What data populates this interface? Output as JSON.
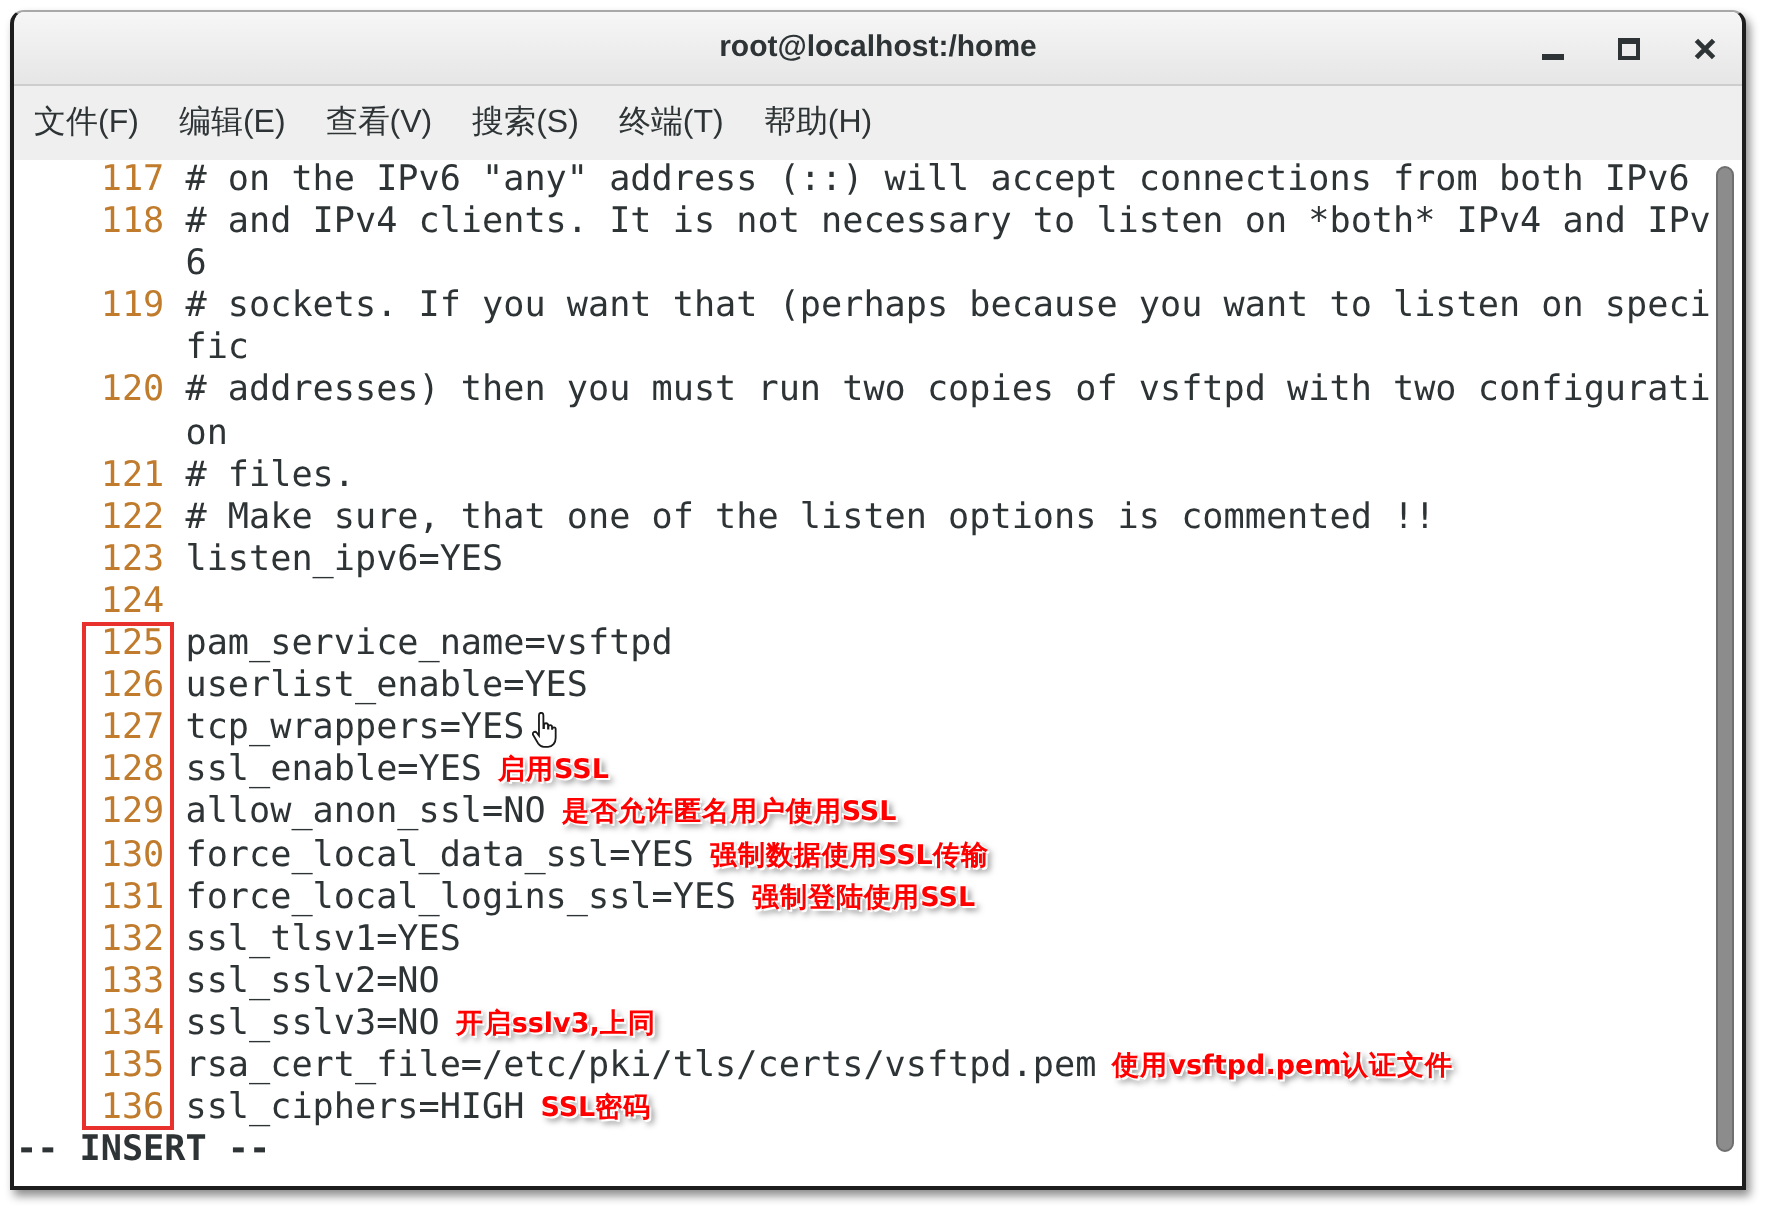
{
  "window": {
    "title": "root@localhost:/home"
  },
  "menu": [
    "文件(F)",
    "编辑(E)",
    "查看(V)",
    "搜索(S)",
    "终端(T)",
    "帮助(H)"
  ],
  "sections": [
    {
      "framed": false,
      "lines": [
        {
          "number": "117",
          "text": "# on the IPv6 \"any\" address (::) will accept connections from both IPv6",
          "mouse_pointer": false
        },
        {
          "number": "118",
          "text": "# and IPv4 clients. It is not necessary to listen on *both* IPv4 and IPv6",
          "mouse_pointer": false
        },
        {
          "number": "119",
          "text": "# sockets. If you want that (perhaps because you want to listen on specific",
          "mouse_pointer": false
        },
        {
          "number": "120",
          "text": "# addresses) then you must run two copies of vsftpd with two configuration",
          "mouse_pointer": false
        },
        {
          "number": "121",
          "text": "# files.",
          "mouse_pointer": false
        },
        {
          "number": "122",
          "text": "# Make sure, that one of the listen options is commented !!",
          "mouse_pointer": false
        },
        {
          "number": "123",
          "text": "listen_ipv6=YES",
          "mouse_pointer": false
        },
        {
          "number": "124",
          "mouse_pointer": false
        }
      ]
    },
    {
      "framed": true,
      "lines": [
        {
          "number": "125",
          "text": "pam_service_name=vsftpd",
          "mouse_pointer": false
        },
        {
          "number": "126",
          "text": "userlist_enable=YES",
          "mouse_pointer": false
        },
        {
          "number": "127",
          "text": "tcp_wrappers=YES",
          "mouse_pointer": true
        },
        {
          "number": "128",
          "text": "ssl_enable=YES",
          "note": "启用SSL",
          "mouse_pointer": false
        },
        {
          "number": "129",
          "text": "allow_anon_ssl=NO",
          "note": "是否允许匿名用户使用SSL",
          "mouse_pointer": false
        },
        {
          "number": "130",
          "text": "force_local_data_ssl=YES",
          "note": "强制数据使用SSL传输",
          "mouse_pointer": false
        },
        {
          "number": "131",
          "text": "force_local_logins_ssl=YES",
          "note": "强制登陆使用SSL",
          "mouse_pointer": false
        },
        {
          "number": "132",
          "text": "ssl_tlsv1=YES",
          "mouse_pointer": false
        },
        {
          "number": "133",
          "text": "ssl_sslv2=NO",
          "mouse_pointer": false
        },
        {
          "number": "134",
          "text": "ssl_sslv3=NO",
          "note": "开启sslv3,上同",
          "mouse_pointer": false
        },
        {
          "number": "135",
          "text": "rsa_cert_file=/etc/pki/tls/certs/vsftpd.pem",
          "note": "使用vsftpd.pem认证文件",
          "mouse_pointer": false
        },
        {
          "number": "136",
          "text": "ssl_ciphers=HIGH",
          "note": "SSL密码",
          "mouse_pointer": false
        }
      ]
    }
  ],
  "status_line": "-- INSERT --"
}
